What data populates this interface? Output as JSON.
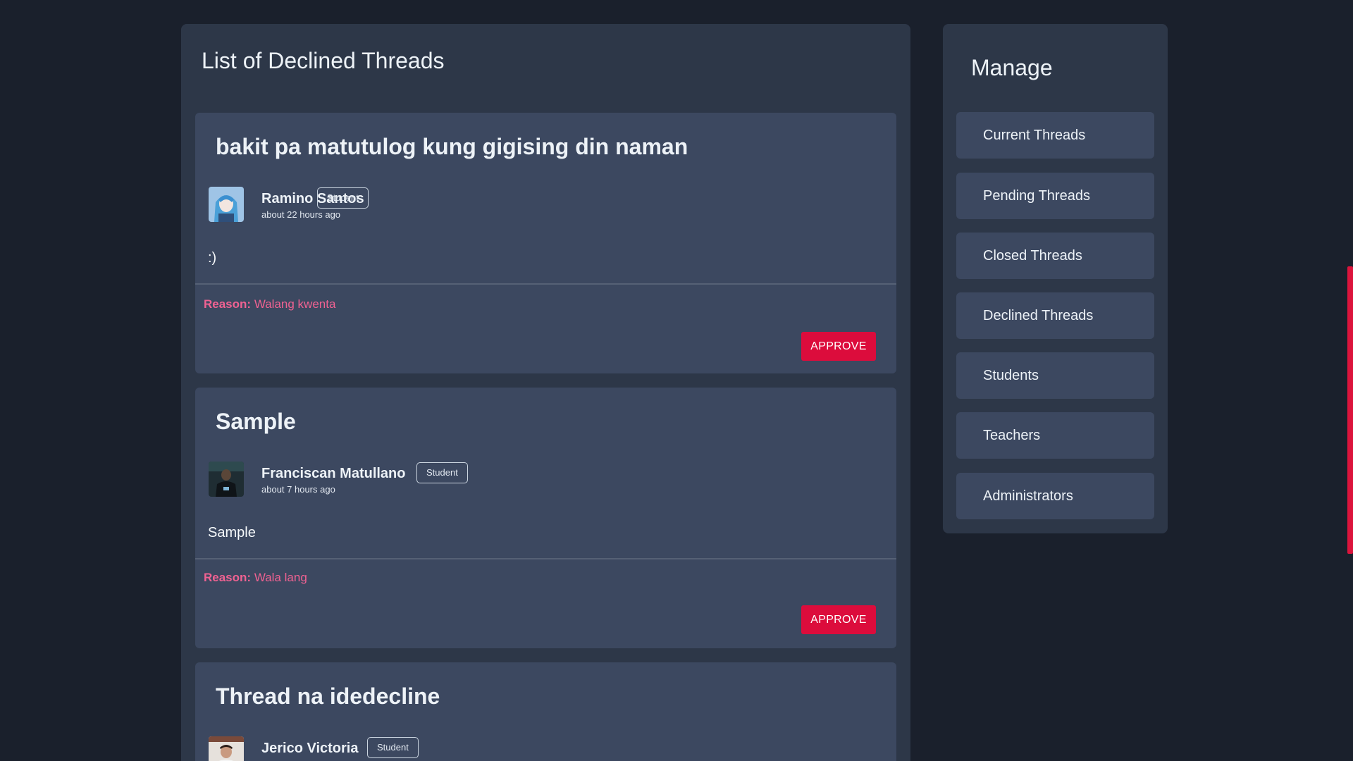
{
  "main": {
    "title": "List of Declined Threads"
  },
  "threads": [
    {
      "title": "bakit pa matutulog kung gigising din naman",
      "author": "Ramino Santos",
      "role": "Student",
      "time": "about 22 hours ago",
      "body": ":)",
      "reason_label": "Reason:",
      "reason_text": "Walang kwenta",
      "action_label": "APPROVE"
    },
    {
      "title": "Sample",
      "author": "Franciscan Matullano",
      "role": "Student",
      "time": "about 7 hours ago",
      "body": "Sample",
      "reason_label": "Reason:",
      "reason_text": "Wala lang",
      "action_label": "APPROVE"
    },
    {
      "title": "Thread na idedecline",
      "author": "Jerico Victoria",
      "role": "Student"
    }
  ],
  "sidebar": {
    "title": "Manage",
    "items": [
      {
        "label": "Current Threads"
      },
      {
        "label": "Pending Threads"
      },
      {
        "label": "Closed Threads"
      },
      {
        "label": "Declined Threads"
      },
      {
        "label": "Students"
      },
      {
        "label": "Teachers"
      },
      {
        "label": "Administrators"
      }
    ]
  },
  "colors": {
    "background": "#1a202c",
    "panel": "#2d3748",
    "card": "#3c4860",
    "reason": "#f06292",
    "approve": "#dc0c3c",
    "scrollbar_thumb": "#dc143c"
  }
}
